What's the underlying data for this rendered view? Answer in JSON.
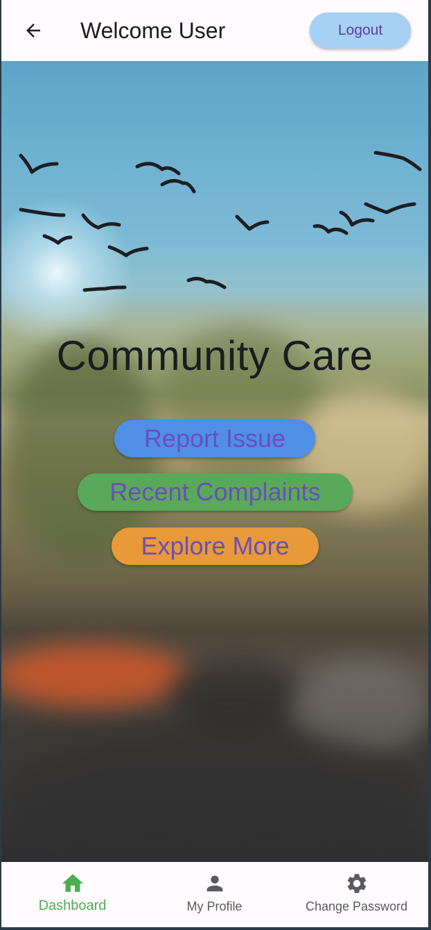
{
  "app_bar": {
    "title": "Welcome User",
    "logout_label": "Logout",
    "back_icon": "arrow-back-icon"
  },
  "hero": {
    "title": "Community Care",
    "actions": [
      {
        "label": "Report Issue",
        "color": "#4f8fe6"
      },
      {
        "label": "Recent Complaints",
        "color": "#5aa85a"
      },
      {
        "label": "Explore More",
        "color": "#e89a38"
      }
    ]
  },
  "bottom_nav": {
    "items": [
      {
        "label": "Dashboard",
        "icon": "home-icon",
        "active": true
      },
      {
        "label": "My Profile",
        "icon": "person-icon",
        "active": false
      },
      {
        "label": "Change Password",
        "icon": "gear-icon",
        "active": false
      }
    ]
  },
  "colors": {
    "active": "#4caf50",
    "inactive": "#5b5b5b",
    "button_text": "#6a4fb8",
    "logout_bg": "#a6d0f4"
  }
}
